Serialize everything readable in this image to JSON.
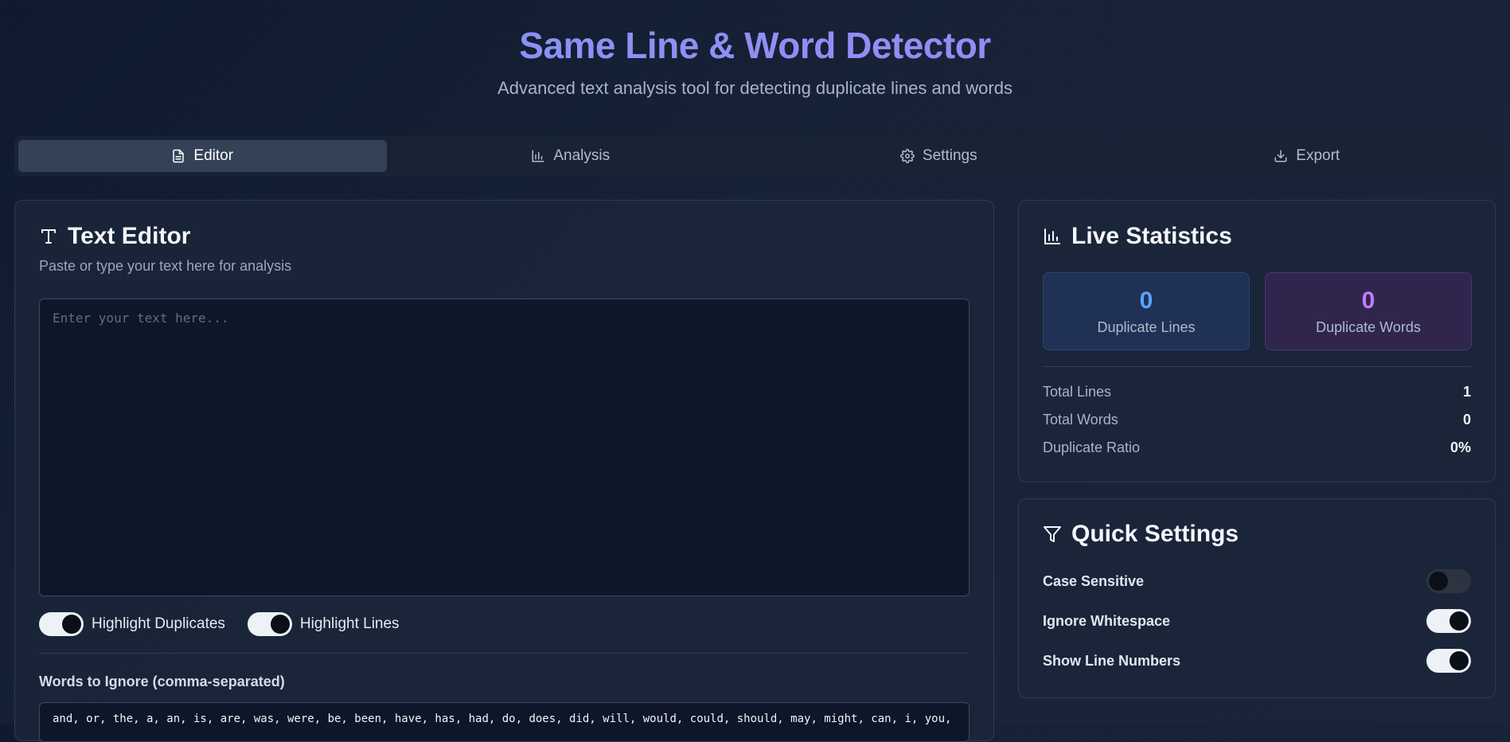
{
  "header": {
    "title": "Same Line & Word Detector",
    "subtitle": "Advanced text analysis tool for detecting duplicate lines and words"
  },
  "tabs": [
    {
      "label": "Editor",
      "icon": "file-text-icon",
      "active": true
    },
    {
      "label": "Analysis",
      "icon": "bar-chart-icon",
      "active": false
    },
    {
      "label": "Settings",
      "icon": "gear-icon",
      "active": false
    },
    {
      "label": "Export",
      "icon": "download-icon",
      "active": false
    }
  ],
  "editor": {
    "title": "Text Editor",
    "icon": "type-icon",
    "subtitle": "Paste or type your text here for analysis",
    "text_value": "",
    "placeholder": "Enter your text here...",
    "toggles": [
      {
        "label": "Highlight Duplicates",
        "on": true
      },
      {
        "label": "Highlight Lines",
        "on": true
      }
    ],
    "ignore_label": "Words to Ignore (comma-separated)",
    "ignore_value": "and, or, the, a, an, is, are, was, were, be, been, have, has, had, do, does, did, will, would, could, should, may, might, can, i, you,"
  },
  "stats": {
    "title": "Live Statistics",
    "icon": "bar-chart-icon",
    "duplicate_lines": {
      "value": "0",
      "label": "Duplicate Lines",
      "color": "#5aa2ff"
    },
    "duplicate_words": {
      "value": "0",
      "label": "Duplicate Words",
      "color": "#c07cff"
    },
    "rows": [
      {
        "label": "Total Lines",
        "value": "1"
      },
      {
        "label": "Total Words",
        "value": "0"
      },
      {
        "label": "Duplicate Ratio",
        "value": "0%"
      }
    ]
  },
  "quick_settings": {
    "title": "Quick Settings",
    "icon": "filter-icon",
    "items": [
      {
        "label": "Case Sensitive",
        "on": false
      },
      {
        "label": "Ignore Whitespace",
        "on": true
      },
      {
        "label": "Show Line Numbers",
        "on": true
      }
    ]
  }
}
